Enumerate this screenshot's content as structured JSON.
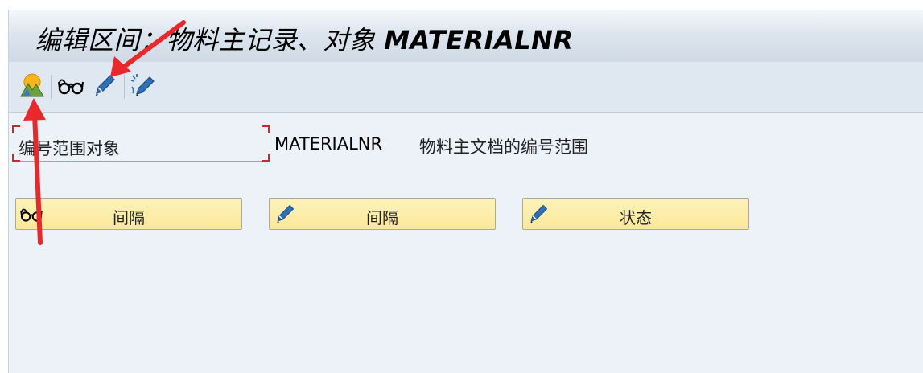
{
  "header": {
    "title_prefix": "编辑区间：物料主记录、对象",
    "title_object": "MATERIALNR"
  },
  "toolbar": {
    "buttons": [
      {
        "icon": "change-mode-icon",
        "tooltip": "切换显示/修改"
      },
      {
        "icon": "glasses-icon",
        "tooltip": "显示"
      },
      {
        "icon": "pencil-icon",
        "tooltip": "修改"
      },
      {
        "icon": "pencil-sparkle-icon",
        "tooltip": "修改状态"
      }
    ]
  },
  "field": {
    "label": "编号范围对象",
    "value": "MATERIALNR",
    "description": "物料主文档的编号范围"
  },
  "actions": [
    {
      "icon": "glasses-icon",
      "label": "间隔"
    },
    {
      "icon": "pencil-icon",
      "label": "间隔"
    },
    {
      "icon": "pencil-icon",
      "label": "状态"
    }
  ],
  "colors": {
    "annotation_arrow": "#e8282b",
    "button_fill": "#fbe89a",
    "icon_blue": "#2f6fb2"
  }
}
